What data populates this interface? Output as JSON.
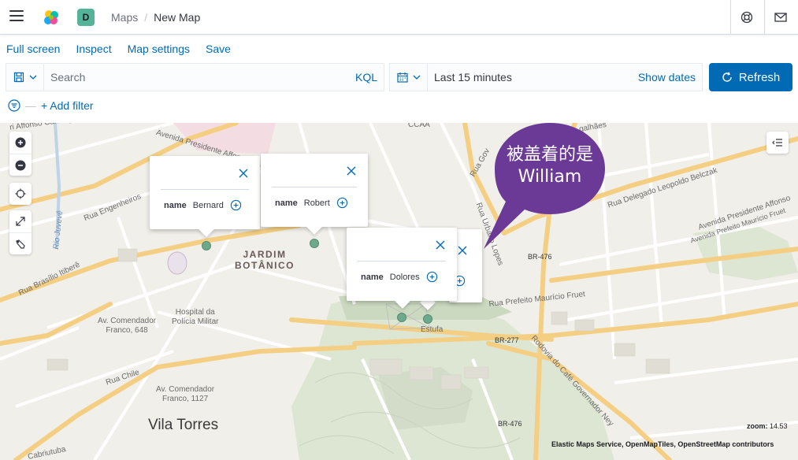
{
  "header": {
    "space_initial": "D",
    "breadcrumbs": [
      "Maps",
      "New Map"
    ],
    "icons": [
      "menu-icon",
      "elastic-logo",
      "help-icon",
      "mail-icon"
    ]
  },
  "topnav": {
    "items": [
      "Full screen",
      "Inspect",
      "Map settings",
      "Save"
    ]
  },
  "querybar": {
    "search_placeholder": "Search",
    "language": "KQL"
  },
  "datebar": {
    "range": "Last 15 minutes",
    "show_dates": "Show dates"
  },
  "refresh": {
    "label": "Refresh"
  },
  "filters": {
    "add_label": "+ Add filter"
  },
  "map": {
    "labels": {
      "district": "JARDIM\nBOTÂNICO",
      "city": "Vila Torres",
      "hospital": "Hospital da\nPolícia Militar",
      "av1": "Av. Comendador\nFranco, 648",
      "av2": "Av. Comendador\nFranco, 1127",
      "estufa": "Estufa",
      "br476a": "BR-476",
      "br476b": "BR-476",
      "br277": "BR-277",
      "ccaa": "CCAA",
      "st1": "Avenida Presidente Affonso Camargo",
      "st2": "Rua Engenheiros",
      "st3": "Rua Brasílio Itiberê",
      "st4": "Rua Chile",
      "st5": "Rua Delegado Leopoldo Belczak",
      "st6": "Avenida Presidente Affonso",
      "st7": "Avenida Prefeito Maurício Fruet",
      "st8": "Rua Prefeito Maurício Fruet",
      "st9": "Rodovia do Café Governador Ney",
      "st10": "Rua Urbano Lopes",
      "st11": "Rua Gov",
      "st12": "Rio Juvevê",
      "st13": "ri Affonso Camargo",
      "st14": "galhães",
      "st15": "Cabriutuba"
    },
    "popups": [
      {
        "field": "name",
        "value": "Bernard"
      },
      {
        "field": "name",
        "value": "Robert"
      },
      {
        "field": "name",
        "value": "Dolores"
      }
    ],
    "annotation": "被盖着的是\nWilliam",
    "attribution": "Elastic Maps Service, OpenMapTiles, OpenStreetMap contributors",
    "zoom_label": "zoom:",
    "zoom_value": "14.53",
    "marker_color": "#6fa98c",
    "bubble_color": "#6b3a96"
  }
}
